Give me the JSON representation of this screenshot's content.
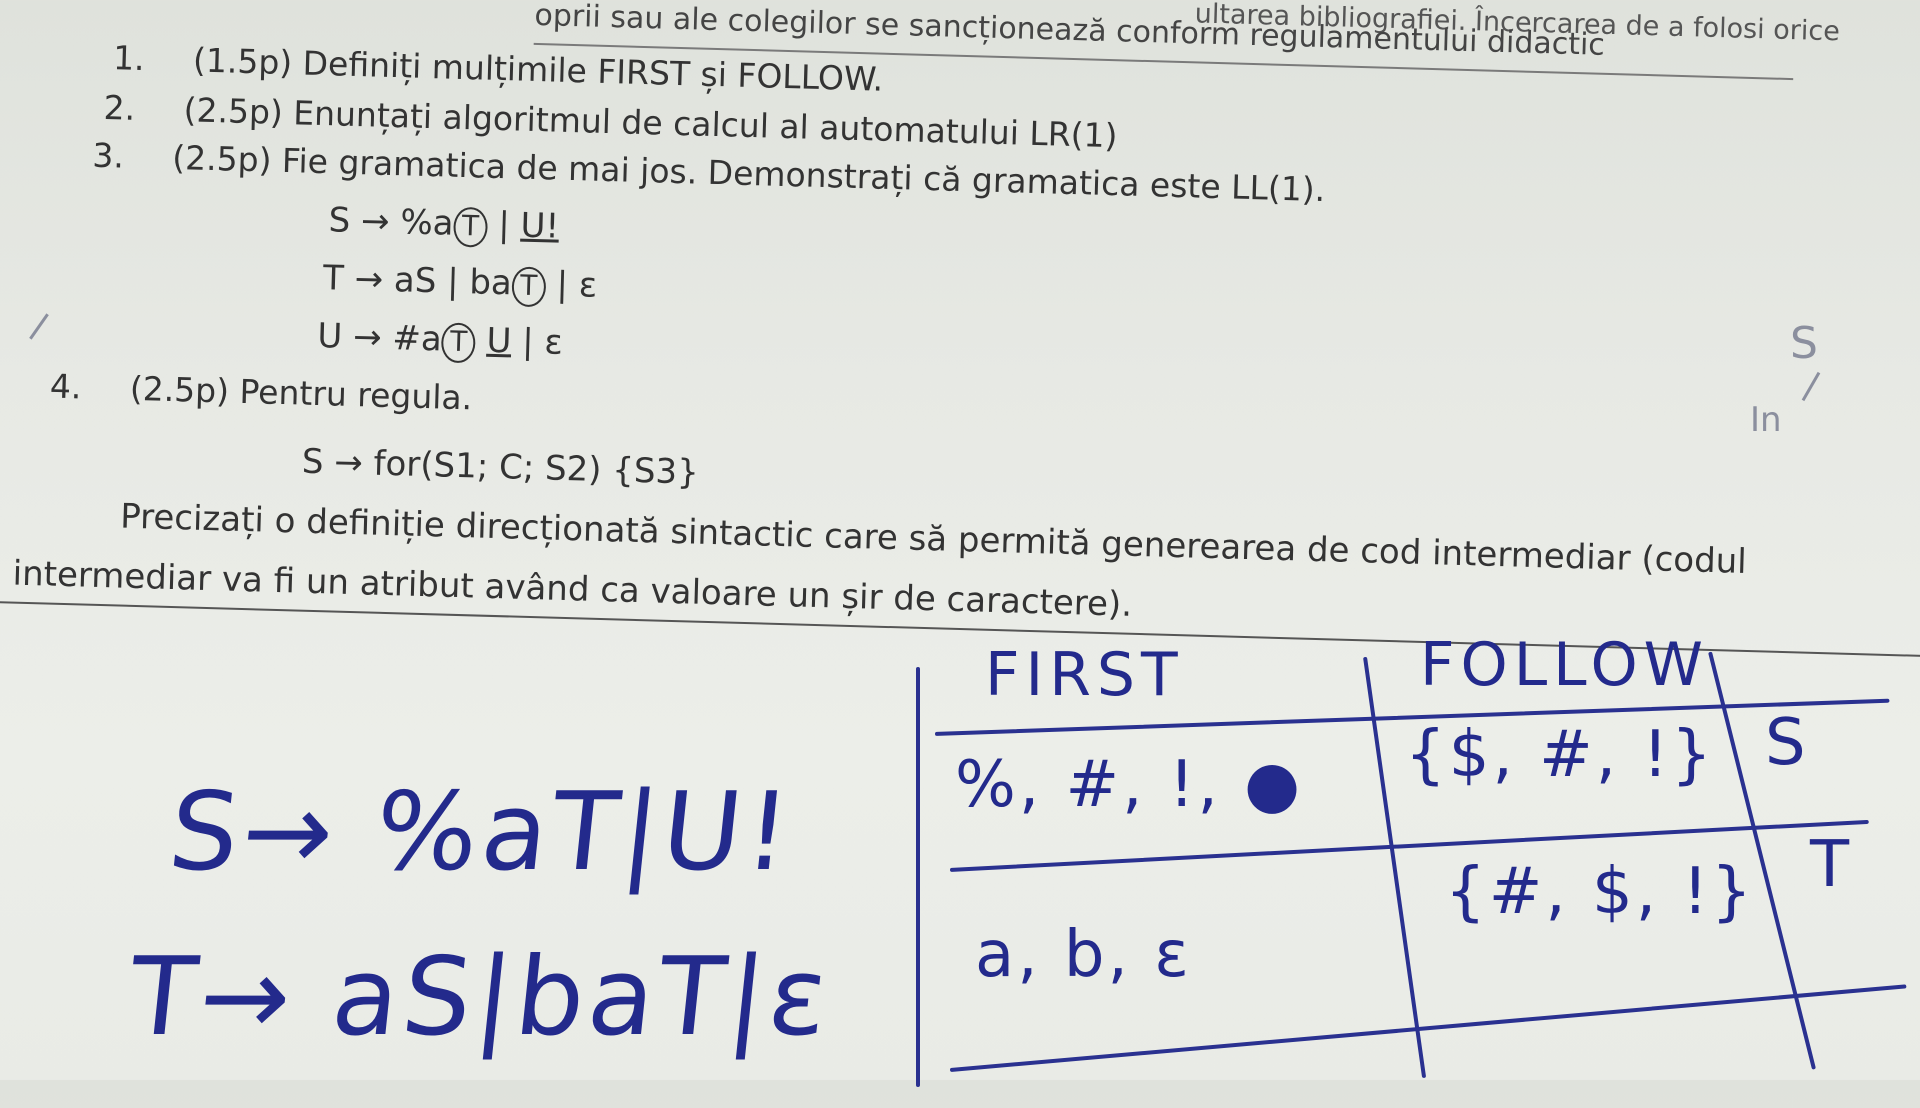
{
  "header": {
    "line1": "ultarea bibliografiei. Încercarea de a folosi orice",
    "line2": "oprii sau ale colegilor se sancționează conform regulamentului didactic"
  },
  "questions": [
    {
      "num": "1.",
      "text": "(1.5p) Definiți mulțimile FIRST și FOLLOW."
    },
    {
      "num": "2.",
      "text": "(2.5p) Enunțați algoritmul de calcul al automatului LR(1)"
    },
    {
      "num": "3.",
      "text": "(2.5p) Fie gramatica de mai jos. Demonstrați că gramatica este LL(1)."
    }
  ],
  "grammar": {
    "s_rule": {
      "lhs": "S",
      "rhs_a": "%a",
      "rhs_b": "| ",
      "rhs_c": "U!"
    },
    "t_rule": {
      "lhs": "T",
      "rhs_a": "aS | ba",
      "rhs_b": "| ε"
    },
    "u_rule": {
      "lhs": "U",
      "rhs_a": "#a",
      "rhs_b": "U",
      "rhs_c": "| ε"
    },
    "circled": "T",
    "arrow": "→"
  },
  "question4": {
    "num": "4.",
    "text": "(2.5p) Pentru regula.",
    "rule": "S → for(S1; C; S2) {S3}",
    "para1": "Precizați o definiție direcționată sintactic care să permită generearea de cod intermediar (codul",
    "para2": "intermediar va fi un atribut având ca valoare un șir de caractere)."
  },
  "handwriting": {
    "left_s": "S→ %aT|U!",
    "left_t": "T→ aS|baT|ε",
    "table": {
      "col_first": "FIRST",
      "col_follow": "FOLLOW",
      "rows": [
        {
          "first": "%, #, !, ●",
          "follow": "{$, #, !}",
          "nt": "S"
        },
        {
          "first": "a, b, ε",
          "follow": "{#, $, !}",
          "nt": "T"
        }
      ]
    },
    "margin_s": "S",
    "margin_in": "In"
  }
}
